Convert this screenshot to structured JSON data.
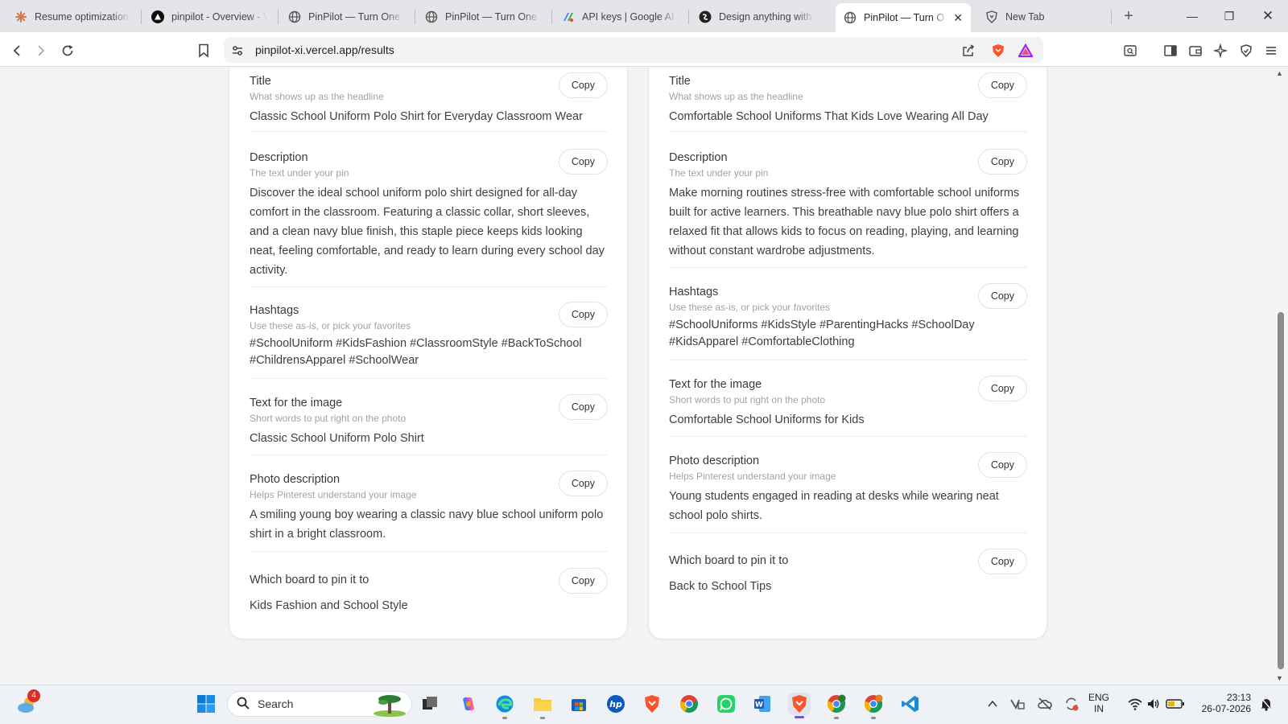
{
  "browser": {
    "tabs": [
      {
        "title": "Resume optimization",
        "icon": "claude-icon"
      },
      {
        "title": "pinpilot - Overview - V",
        "icon": "vercel-icon"
      },
      {
        "title": "PinPilot — Turn One F",
        "icon": "globe-icon"
      },
      {
        "title": "PinPilot — Turn One F",
        "icon": "globe-icon"
      },
      {
        "title": "API keys | Google AI S",
        "icon": "google-ai-icon"
      },
      {
        "title": "Design anything with",
        "icon": "design-icon"
      },
      {
        "title": "PinPilot — Turn O",
        "icon": "globe-icon",
        "active": true
      },
      {
        "title": "New Tab",
        "icon": "brave-icon"
      }
    ],
    "url": "pinpilot-xi.vercel.app/results"
  },
  "cards": [
    {
      "sections": [
        {
          "title": "Title",
          "subtitle": "What shows up as the headline",
          "body": "Classic School Uniform Polo Shirt for Everyday Classroom Wear",
          "copy_label": "Copy"
        },
        {
          "title": "Description",
          "subtitle": "The text under your pin",
          "body": "Discover the ideal school uniform polo shirt designed for all-day comfort in the classroom. Featuring a classic collar, short sleeves, and a clean navy blue finish, this staple piece keeps kids looking neat, feeling comfortable, and ready to learn during every school day activity.",
          "copy_label": "Copy"
        },
        {
          "title": "Hashtags",
          "subtitle": "Use these as-is, or pick your favorites",
          "body": "#SchoolUniform #KidsFashion #ClassroomStyle #BackToSchool #ChildrensApparel #SchoolWear",
          "copy_label": "Copy"
        },
        {
          "title": "Text for the image",
          "subtitle": "Short words to put right on the photo",
          "body": "Classic School Uniform Polo Shirt",
          "copy_label": "Copy"
        },
        {
          "title": "Photo description",
          "subtitle": "Helps Pinterest understand your image",
          "body": "A smiling young boy wearing a classic navy blue school uniform polo shirt in a bright classroom.",
          "copy_label": "Copy"
        },
        {
          "title": "Which board to pin it to",
          "subtitle": "",
          "body": "Kids Fashion and School Style",
          "copy_label": "Copy"
        }
      ]
    },
    {
      "sections": [
        {
          "title": "Title",
          "subtitle": "What shows up as the headline",
          "body": "Comfortable School Uniforms That Kids Love Wearing All Day",
          "copy_label": "Copy"
        },
        {
          "title": "Description",
          "subtitle": "The text under your pin",
          "body": "Make morning routines stress-free with comfortable school uniforms built for active learners. This breathable navy blue polo shirt offers a relaxed fit that allows kids to focus on reading, playing, and learning without constant wardrobe adjustments.",
          "copy_label": "Copy"
        },
        {
          "title": "Hashtags",
          "subtitle": "Use these as-is, or pick your favorites",
          "body": "#SchoolUniforms #KidsStyle #ParentingHacks #SchoolDay #KidsApparel #ComfortableClothing",
          "copy_label": "Copy"
        },
        {
          "title": "Text for the image",
          "subtitle": "Short words to put right on the photo",
          "body": "Comfortable School Uniforms for Kids",
          "copy_label": "Copy"
        },
        {
          "title": "Photo description",
          "subtitle": "Helps Pinterest understand your image",
          "body": "Young students engaged in reading at desks while wearing neat school polo shirts.",
          "copy_label": "Copy"
        },
        {
          "title": "Which board to pin it to",
          "subtitle": "",
          "body": "Back to School Tips",
          "copy_label": "Copy"
        }
      ]
    }
  ],
  "taskbar": {
    "weather_badge": "4",
    "search_label": "Search",
    "language": "ENG",
    "region": "IN",
    "time": "23:13",
    "date": "26-07-2026"
  }
}
